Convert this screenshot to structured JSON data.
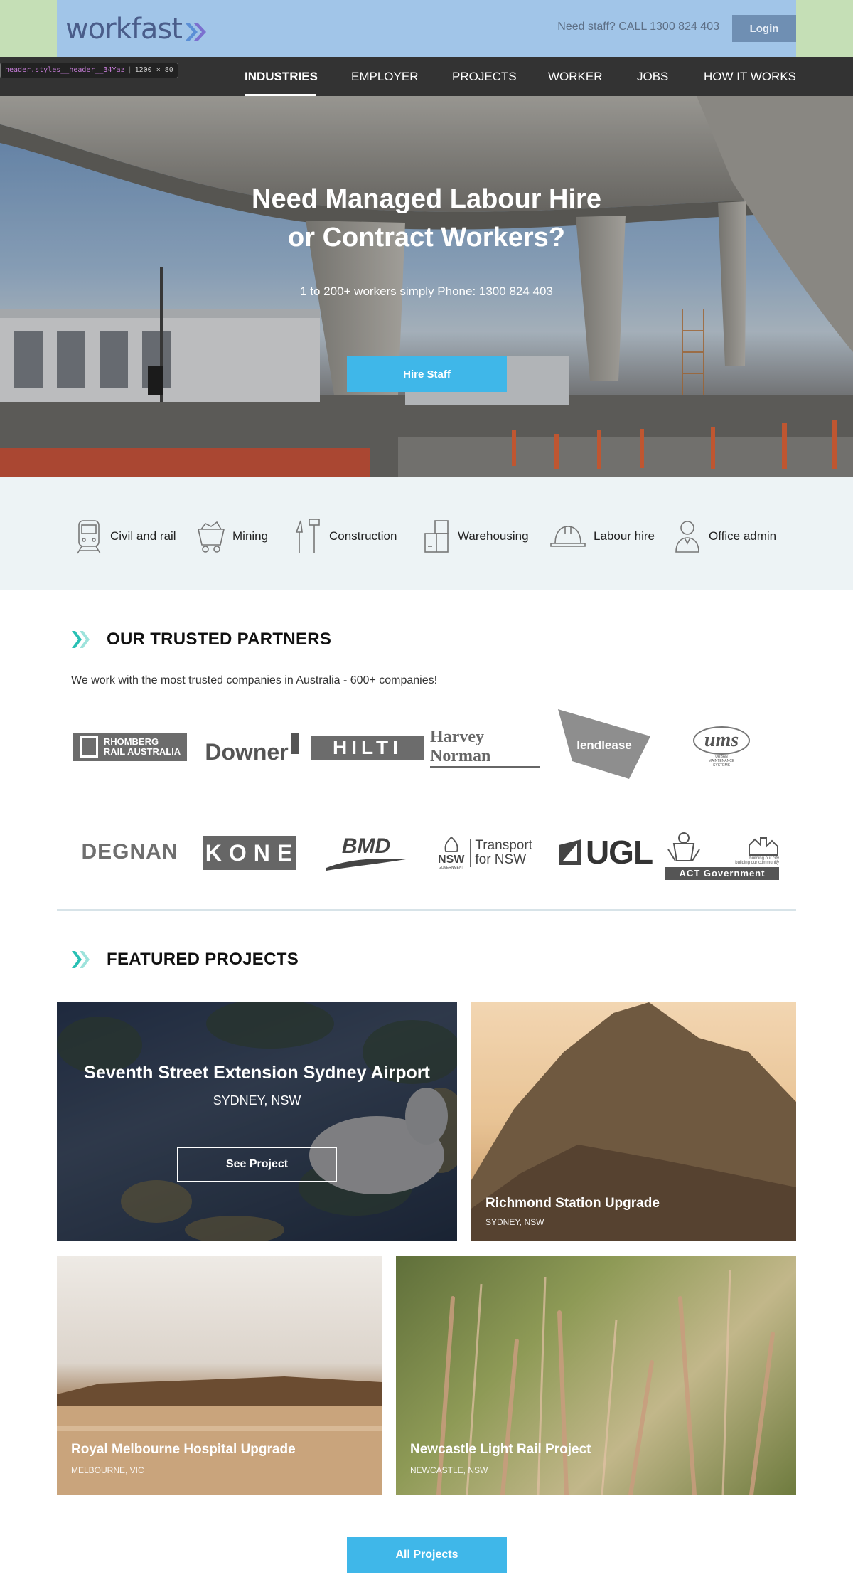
{
  "header": {
    "logo_text": "workfast",
    "need_staff": "Need staff? CALL 1300 824 403",
    "login_label": "Login"
  },
  "devtools_tag": {
    "selector": "header.styles__header__34Yaz",
    "size": "1200 × 80"
  },
  "nav": {
    "items": [
      "INDUSTRIES",
      "EMPLOYER",
      "PROJECTS",
      "WORKER",
      "JOBS",
      "HOW IT WORKS"
    ],
    "active": "INDUSTRIES"
  },
  "hero": {
    "title_line1": "Need Managed Labour Hire",
    "title_line2": "or Contract Workers?",
    "subtitle": "1 to 200+ workers simply Phone: 1300 824 403",
    "cta": "Hire Staff"
  },
  "industries": [
    {
      "label": "Civil and rail",
      "icon": "train-icon"
    },
    {
      "label": "Mining",
      "icon": "mining-cart-icon"
    },
    {
      "label": "Construction",
      "icon": "tools-icon"
    },
    {
      "label": "Warehousing",
      "icon": "boxes-icon"
    },
    {
      "label": "Labour hire",
      "icon": "hard-hat-icon"
    },
    {
      "label": "Office admin",
      "icon": "person-icon"
    }
  ],
  "partners": {
    "title": "OUR TRUSTED PARTNERS",
    "description": "We work with the most trusted companies in Australia - 600+ companies!",
    "logos": {
      "rhomberg_1": "RHOMBERG",
      "rhomberg_2": "RAIL AUSTRALIA",
      "downer": "Downer",
      "hilti": "HILTI",
      "harvey": "Harvey Norman",
      "lendlease": "lendlease",
      "ums": "ums",
      "ums_sub": "URBAN MAINTENANCE SYSTEMS",
      "degnan": "DEGNAN",
      "kone": "KONE",
      "bmd": "BMD",
      "nsw": "NSW",
      "nsw_sub": "GOVERNMENT",
      "transport_1": "Transport",
      "transport_2": "for NSW",
      "ugl": "UGL",
      "act_1": "building our city",
      "act_2": "building our community",
      "act_gov": "ACT Government"
    }
  },
  "projects": {
    "title": "FEATURED PROJECTS",
    "cards": [
      {
        "title": "Seventh Street Extension Sydney Airport",
        "location": "SYDNEY, NSW",
        "cta": "See Project"
      },
      {
        "title": "Richmond Station Upgrade",
        "location": "SYDNEY, NSW"
      },
      {
        "title": "Royal Melbourne Hospital Upgrade",
        "location": "MELBOURNE, VIC"
      },
      {
        "title": "Newcastle Light Rail Project",
        "location": "NEWCASTLE, NSW"
      }
    ],
    "all_cta": "All Projects"
  },
  "colors": {
    "accent": "#3fb7e9",
    "nav_bg": "#333333",
    "header_bg": "#a1c5e8",
    "industries_bg": "#edf3f5",
    "chevron": "#29c0b4"
  }
}
